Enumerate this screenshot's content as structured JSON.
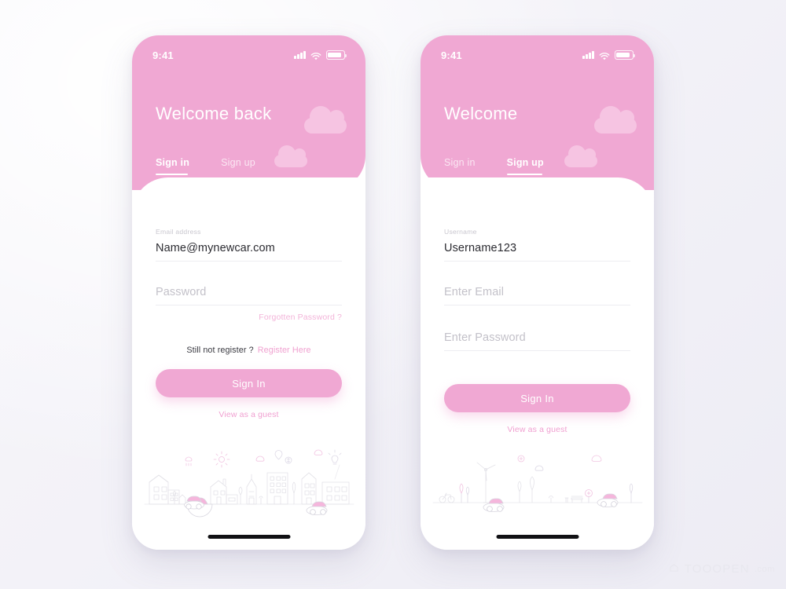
{
  "meta": {
    "colors": {
      "brand_pink": "#f0a8d3",
      "cloud_pink": "#f6c4e2",
      "link_pink": "#f09fd0",
      "page_background": "#f3f2f8",
      "text_dark": "#2b2b31",
      "label_gray": "#c9c7cf"
    }
  },
  "watermark": {
    "mark": "TOOOPEN",
    "suffix": ".com"
  },
  "screens": [
    {
      "id": "sign-in",
      "status_bar": {
        "time": "9:41",
        "signal_icon": "signal-bars-icon",
        "wifi_icon": "wifi-icon",
        "battery_icon": "battery-icon"
      },
      "header": {
        "title": "Welcome back",
        "tabs": [
          {
            "label": "Sign in",
            "active": true
          },
          {
            "label": "Sign up",
            "active": false
          }
        ]
      },
      "form": {
        "fields": [
          {
            "label": "Email address",
            "value": "Name@mynewcar.com",
            "placeholder": "",
            "filled": true
          },
          {
            "label": "",
            "value": "",
            "placeholder": "Password",
            "filled": false
          }
        ],
        "helper_link": "Forgotten Password  ?",
        "register_prompt": "Still not register ?",
        "register_link": "Register Here",
        "cta_label": "Sign In",
        "guest_label": "View as a guest"
      },
      "illustration": "city-skyline-illustration"
    },
    {
      "id": "sign-up",
      "status_bar": {
        "time": "9:41",
        "signal_icon": "signal-bars-icon",
        "wifi_icon": "wifi-icon",
        "battery_icon": "battery-icon"
      },
      "header": {
        "title": "Welcome",
        "tabs": [
          {
            "label": "Sign in",
            "active": false
          },
          {
            "label": "Sign up",
            "active": true
          }
        ]
      },
      "form": {
        "fields": [
          {
            "label": "Username",
            "value": "Username123",
            "placeholder": "",
            "filled": true
          },
          {
            "label": "",
            "value": "",
            "placeholder": "Enter Email",
            "filled": false
          },
          {
            "label": "",
            "value": "",
            "placeholder": "Enter Password",
            "filled": false
          }
        ],
        "helper_link": "",
        "register_prompt": "",
        "register_link": "",
        "cta_label": "Sign In",
        "guest_label": "View as a guest"
      },
      "illustration": "countryside-illustration"
    }
  ]
}
